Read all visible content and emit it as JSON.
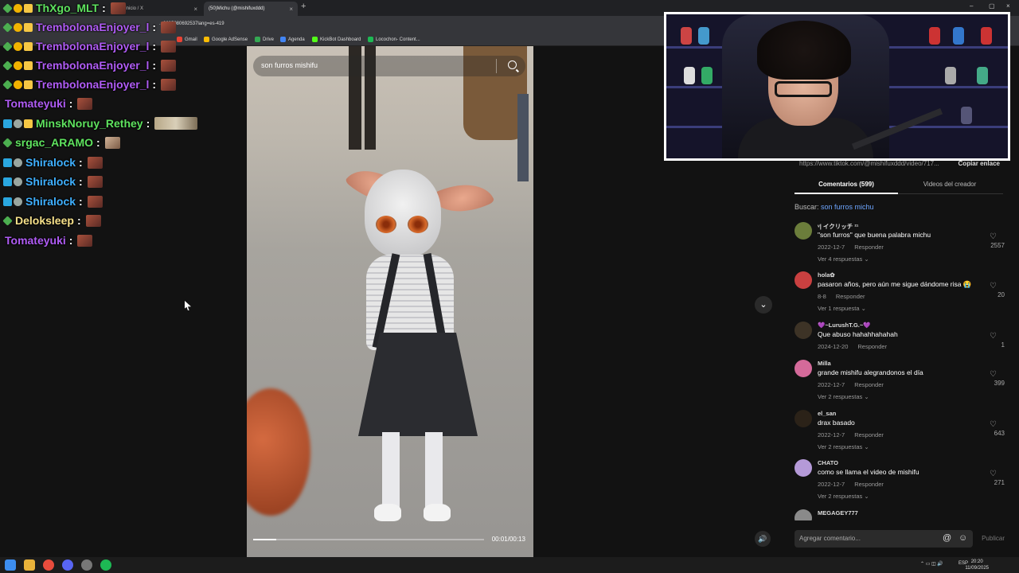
{
  "browser": {
    "tabs": [
      {
        "label": "(8) Inicio / X"
      },
      {
        "label": "(50)Michu (@mishifuxddd)"
      }
    ],
    "url": "...0695080692537lang=es-419",
    "bookmarks": [
      "Gmail",
      "Google AdSense",
      "Drive",
      "Agenda",
      "KickBot Dashboard",
      "Locochon- Content..."
    ]
  },
  "chat": [
    {
      "user": "ThXgo_MLT",
      "color": "#5fe35f"
    },
    {
      "user": "TrembolonaEnjoyer_l",
      "color": "#b05cf5"
    },
    {
      "user": "TrembolonaEnjoyer_l",
      "color": "#b05cf5"
    },
    {
      "user": "TrembolonaEnjoyer_l",
      "color": "#b05cf5"
    },
    {
      "user": "TrembolonaEnjoyer_l",
      "color": "#b05cf5"
    },
    {
      "user": "Tomateyuki",
      "color": "#b05cf5"
    },
    {
      "user": "MinskNoruy_Rethey",
      "color": "#5fe35f"
    },
    {
      "user": "srgac_ARAMO",
      "color": "#5fe35f"
    },
    {
      "user": "Shiralock",
      "color": "#3fb0ff"
    },
    {
      "user": "Shiralock",
      "color": "#3fb0ff"
    },
    {
      "user": "Shiralock",
      "color": "#3fb0ff"
    },
    {
      "user": "Deloksleep",
      "color": "#f6e08a"
    },
    {
      "user": "Tomateyuki",
      "color": "#b05cf5"
    }
  ],
  "video": {
    "search_text": "son furros mishifu",
    "time": "00:01/00:13",
    "progress": 0.1
  },
  "panel": {
    "link": "https://www.tiktok.com/@mishifuxddd/video/717...",
    "copy_label": "Copiar enlace",
    "tab_comments": "Comentarios (599)",
    "tab_creator": "Videos del creador",
    "search_label": "Buscar:",
    "search_term": "son furros michu",
    "comments": [
      {
        "user": "ᵛ| イクリッチ ²¹",
        "text": "\"son furros\" que buena palabra michu",
        "date": "2022-12-7",
        "reply": "Responder",
        "replies": "Ver 4 respuestas ⌄",
        "likes": "2557",
        "avatar": "#6b7d3b"
      },
      {
        "user": "hola✿",
        "text": "pasaron años, pero aún me sigue dándome risa 😭",
        "date": "8-8",
        "reply": "Responder",
        "replies": "Ver 1 respuesta ⌄",
        "likes": "20",
        "avatar": "#c94040"
      },
      {
        "user": "💜~LurushT.G.~💜",
        "text": "Que abuso hahahhahahah",
        "date": "2024-12-20",
        "reply": "Responder",
        "replies": "",
        "likes": "1",
        "avatar": "#3d3326"
      },
      {
        "user": "Milla",
        "text": "grande mishifu alegrandonos el día",
        "date": "2022-12-7",
        "reply": "Responder",
        "replies": "Ver 2 respuestas ⌄",
        "likes": "399",
        "avatar": "#d46a9a"
      },
      {
        "user": "el_san",
        "text": "drax basado",
        "date": "2022-12-7",
        "reply": "Responder",
        "replies": "Ver 2 respuestas ⌄",
        "likes": "643",
        "avatar": "#2b2218"
      },
      {
        "user": "CHATO",
        "text": "como se llama el video de mishifu",
        "date": "2022-12-7",
        "reply": "Responder",
        "replies": "Ver 2 respuestas ⌄",
        "likes": "271",
        "avatar": "#b59ad8"
      },
      {
        "user": "MEGAGEY777",
        "text": "",
        "date": "",
        "reply": "",
        "replies": "",
        "likes": "",
        "avatar": "#8a8a8a"
      }
    ],
    "add_comment_placeholder": "Agregar comentario...",
    "publish_label": "Publicar"
  },
  "taskbar": {
    "lang": "ESP",
    "time": "20:20",
    "date": "11/09/2025"
  }
}
